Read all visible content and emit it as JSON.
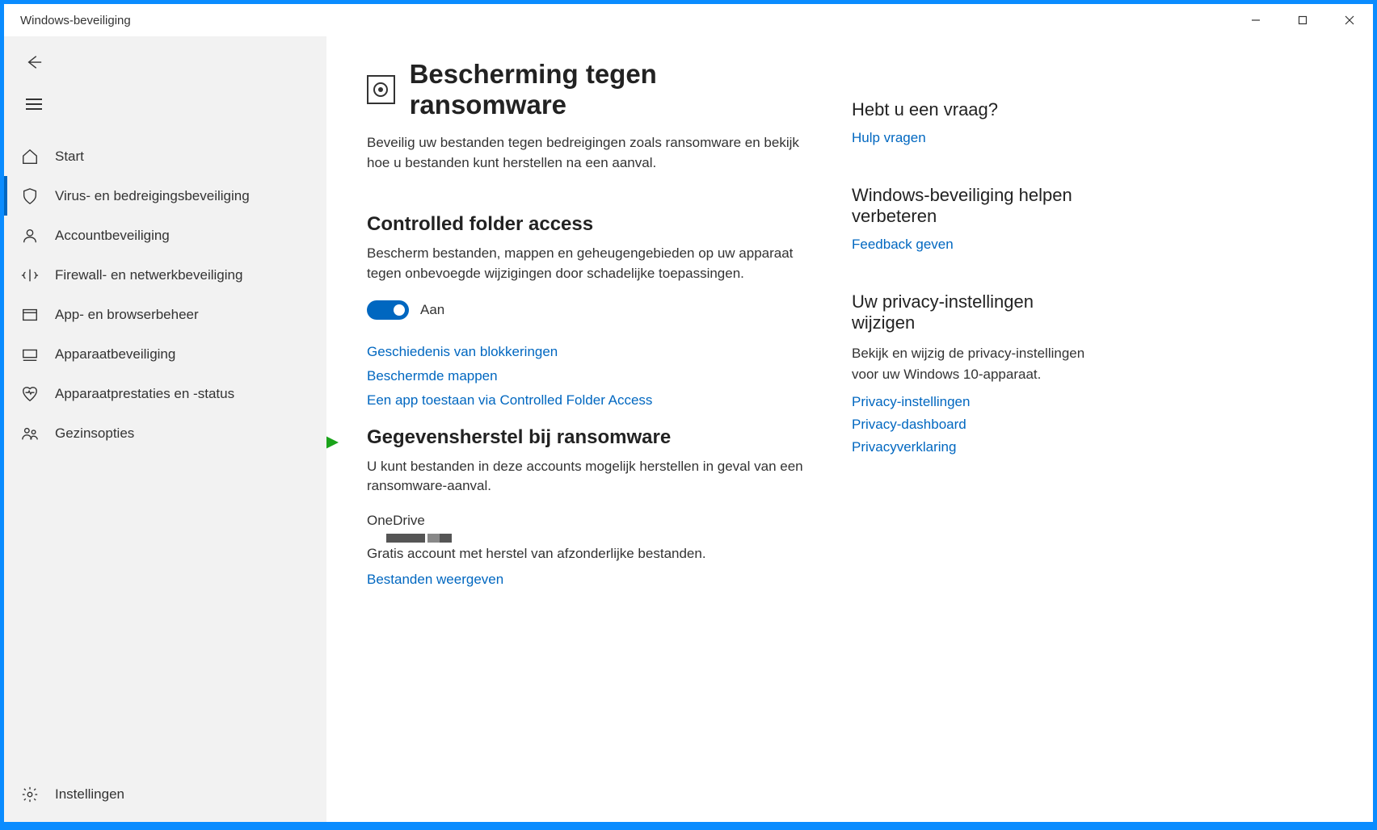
{
  "window": {
    "title": "Windows-beveiliging"
  },
  "sidebar": {
    "items": [
      {
        "label": "Start"
      },
      {
        "label": "Virus- en bedreigingsbeveiliging"
      },
      {
        "label": "Accountbeveiliging"
      },
      {
        "label": "Firewall- en netwerkbeveiliging"
      },
      {
        "label": "App- en browserbeheer"
      },
      {
        "label": "Apparaatbeveiliging"
      },
      {
        "label": "Apparaatprestaties en -status"
      },
      {
        "label": "Gezinsopties"
      }
    ],
    "settings": "Instellingen"
  },
  "main": {
    "title": "Bescherming tegen ransomware",
    "intro": "Beveilig uw bestanden tegen bedreigingen zoals ransomware en bekijk hoe u bestanden kunt herstellen na een aanval.",
    "cfa": {
      "heading": "Controlled folder access",
      "desc": "Bescherm bestanden, mappen en geheugengebieden op uw apparaat tegen onbevoegde wijzigingen door schadelijke toepassingen.",
      "toggle_state": "Aan",
      "links": {
        "history": "Geschiedenis van blokkeringen",
        "protected": "Beschermde mappen",
        "allow": "Een app toestaan via Controlled Folder Access"
      }
    },
    "recovery": {
      "heading": "Gegevensherstel bij ransomware",
      "desc": "U kunt bestanden in deze accounts mogelijk herstellen in geval van een ransomware-aanval.",
      "account": "OneDrive",
      "account_desc": "Gratis account met herstel van afzonderlijke bestanden.",
      "show_files": "Bestanden weergeven"
    }
  },
  "right": {
    "question": {
      "title": "Hebt u een vraag?",
      "link": "Hulp vragen"
    },
    "improve": {
      "title": "Windows-beveiliging helpen verbeteren",
      "link": "Feedback geven"
    },
    "privacy": {
      "title": "Uw privacy-instellingen wijzigen",
      "desc": "Bekijk en wijzig de privacy-instellingen voor uw Windows 10-apparaat.",
      "links": {
        "settings": "Privacy-instellingen",
        "dashboard": "Privacy-dashboard",
        "statement": "Privacyverklaring"
      }
    }
  }
}
